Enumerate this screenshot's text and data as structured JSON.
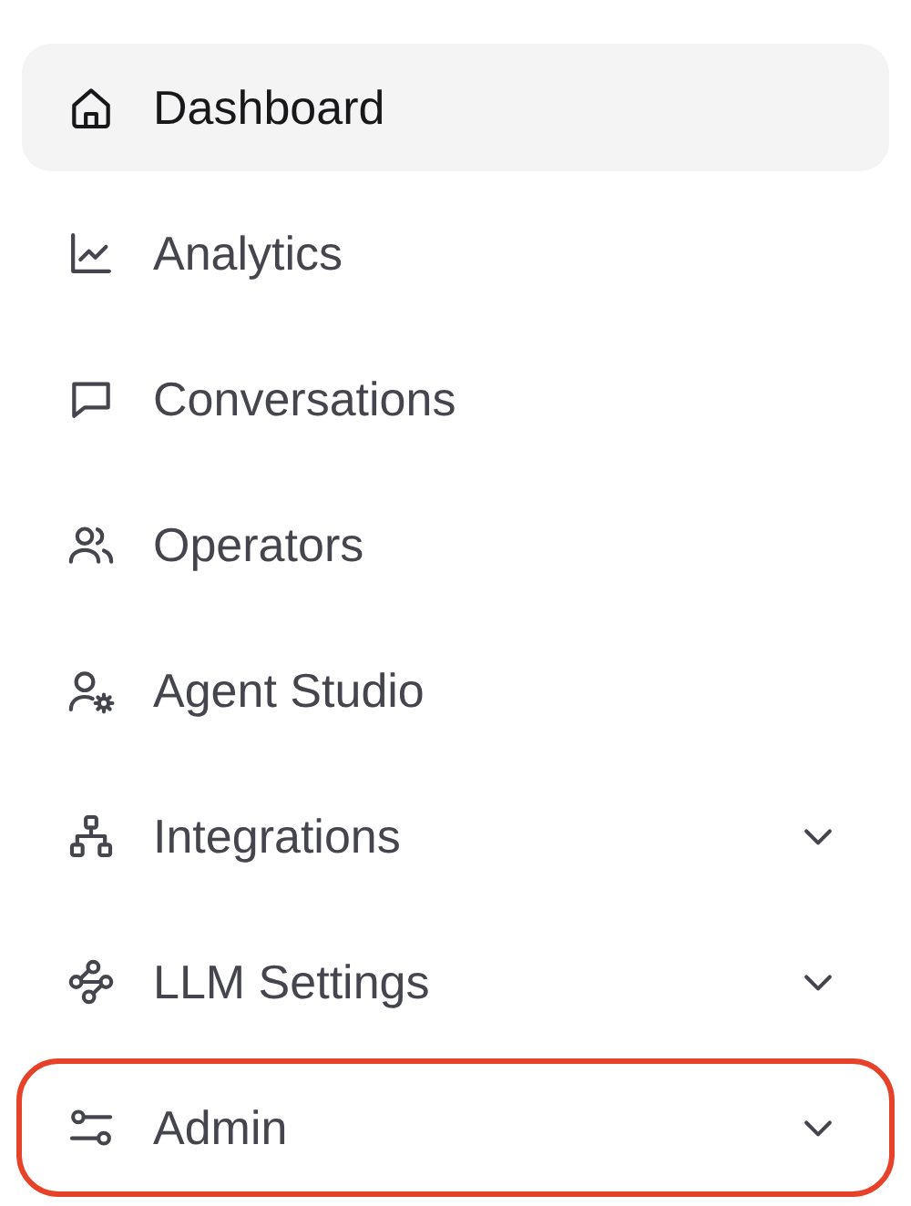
{
  "sidebar": {
    "items": [
      {
        "label": "Dashboard",
        "kind": "link",
        "selected": true,
        "highlighted": false
      },
      {
        "label": "Analytics",
        "kind": "link",
        "selected": false,
        "highlighted": false
      },
      {
        "label": "Conversations",
        "kind": "link",
        "selected": false,
        "highlighted": false
      },
      {
        "label": "Operators",
        "kind": "link",
        "selected": false,
        "highlighted": false
      },
      {
        "label": "Agent Studio",
        "kind": "link",
        "selected": false,
        "highlighted": false
      },
      {
        "label": "Integrations",
        "kind": "group",
        "selected": false,
        "highlighted": false
      },
      {
        "label": "LLM Settings",
        "kind": "group",
        "selected": false,
        "highlighted": false
      },
      {
        "label": "Admin",
        "kind": "group",
        "selected": false,
        "highlighted": true
      }
    ]
  }
}
